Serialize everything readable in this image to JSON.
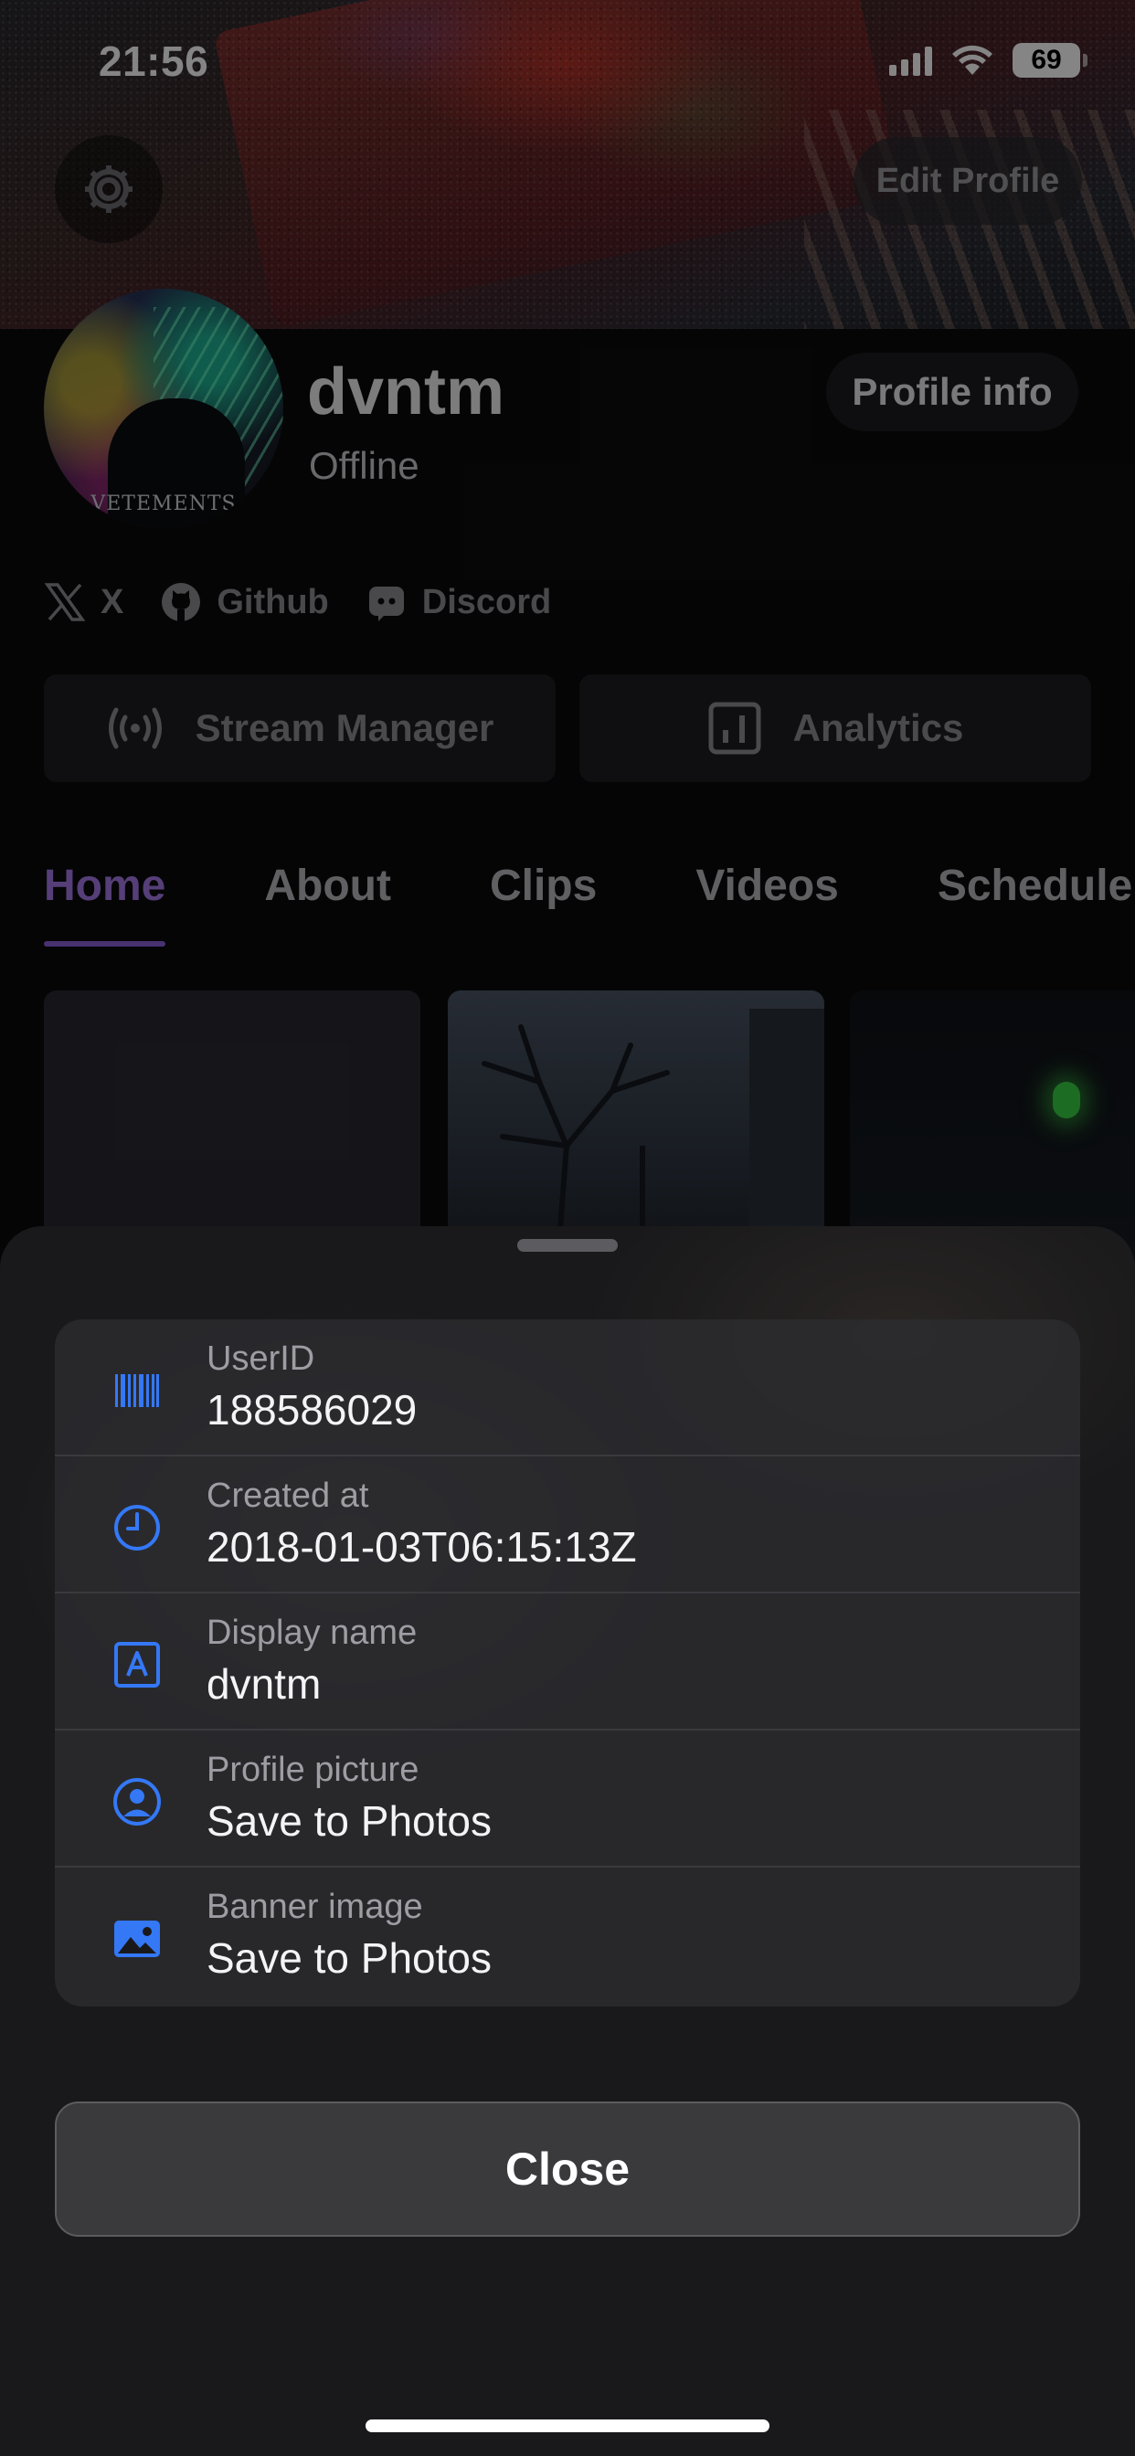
{
  "status_bar": {
    "time": "21:56",
    "battery": "69"
  },
  "banner": {
    "edit_profile_label": "Edit Profile"
  },
  "profile": {
    "username": "dvntm",
    "status": "Offline",
    "avatar_text": "VETEMENTS",
    "profile_info_label": "Profile info"
  },
  "social": [
    {
      "label": "X",
      "icon": "x-logo-icon"
    },
    {
      "label": "Github",
      "icon": "github-icon"
    },
    {
      "label": "Discord",
      "icon": "discord-icon"
    }
  ],
  "actions": {
    "stream_manager": "Stream Manager",
    "analytics": "Analytics"
  },
  "tabs": [
    "Home",
    "About",
    "Clips",
    "Videos",
    "Schedule"
  ],
  "active_tab": "Home",
  "sheet": {
    "rows": [
      {
        "label": "UserID",
        "value": "188586029",
        "icon": "barcode-icon"
      },
      {
        "label": "Created at",
        "value": "2018-01-03T06:15:13Z",
        "icon": "clock-icon"
      },
      {
        "label": "Display name",
        "value": "dvntm",
        "icon": "text-format-icon"
      },
      {
        "label": "Profile picture",
        "value": "Save to Photos",
        "icon": "person-circle-icon"
      },
      {
        "label": "Banner image",
        "value": "Save to Photos",
        "icon": "photo-icon"
      }
    ],
    "close_label": "Close"
  },
  "colors": {
    "accent": "#a57ae6",
    "tab_indicator": "#8b5fd8",
    "icon_blue": "#3478f6",
    "sheet_background": "#19191b"
  }
}
